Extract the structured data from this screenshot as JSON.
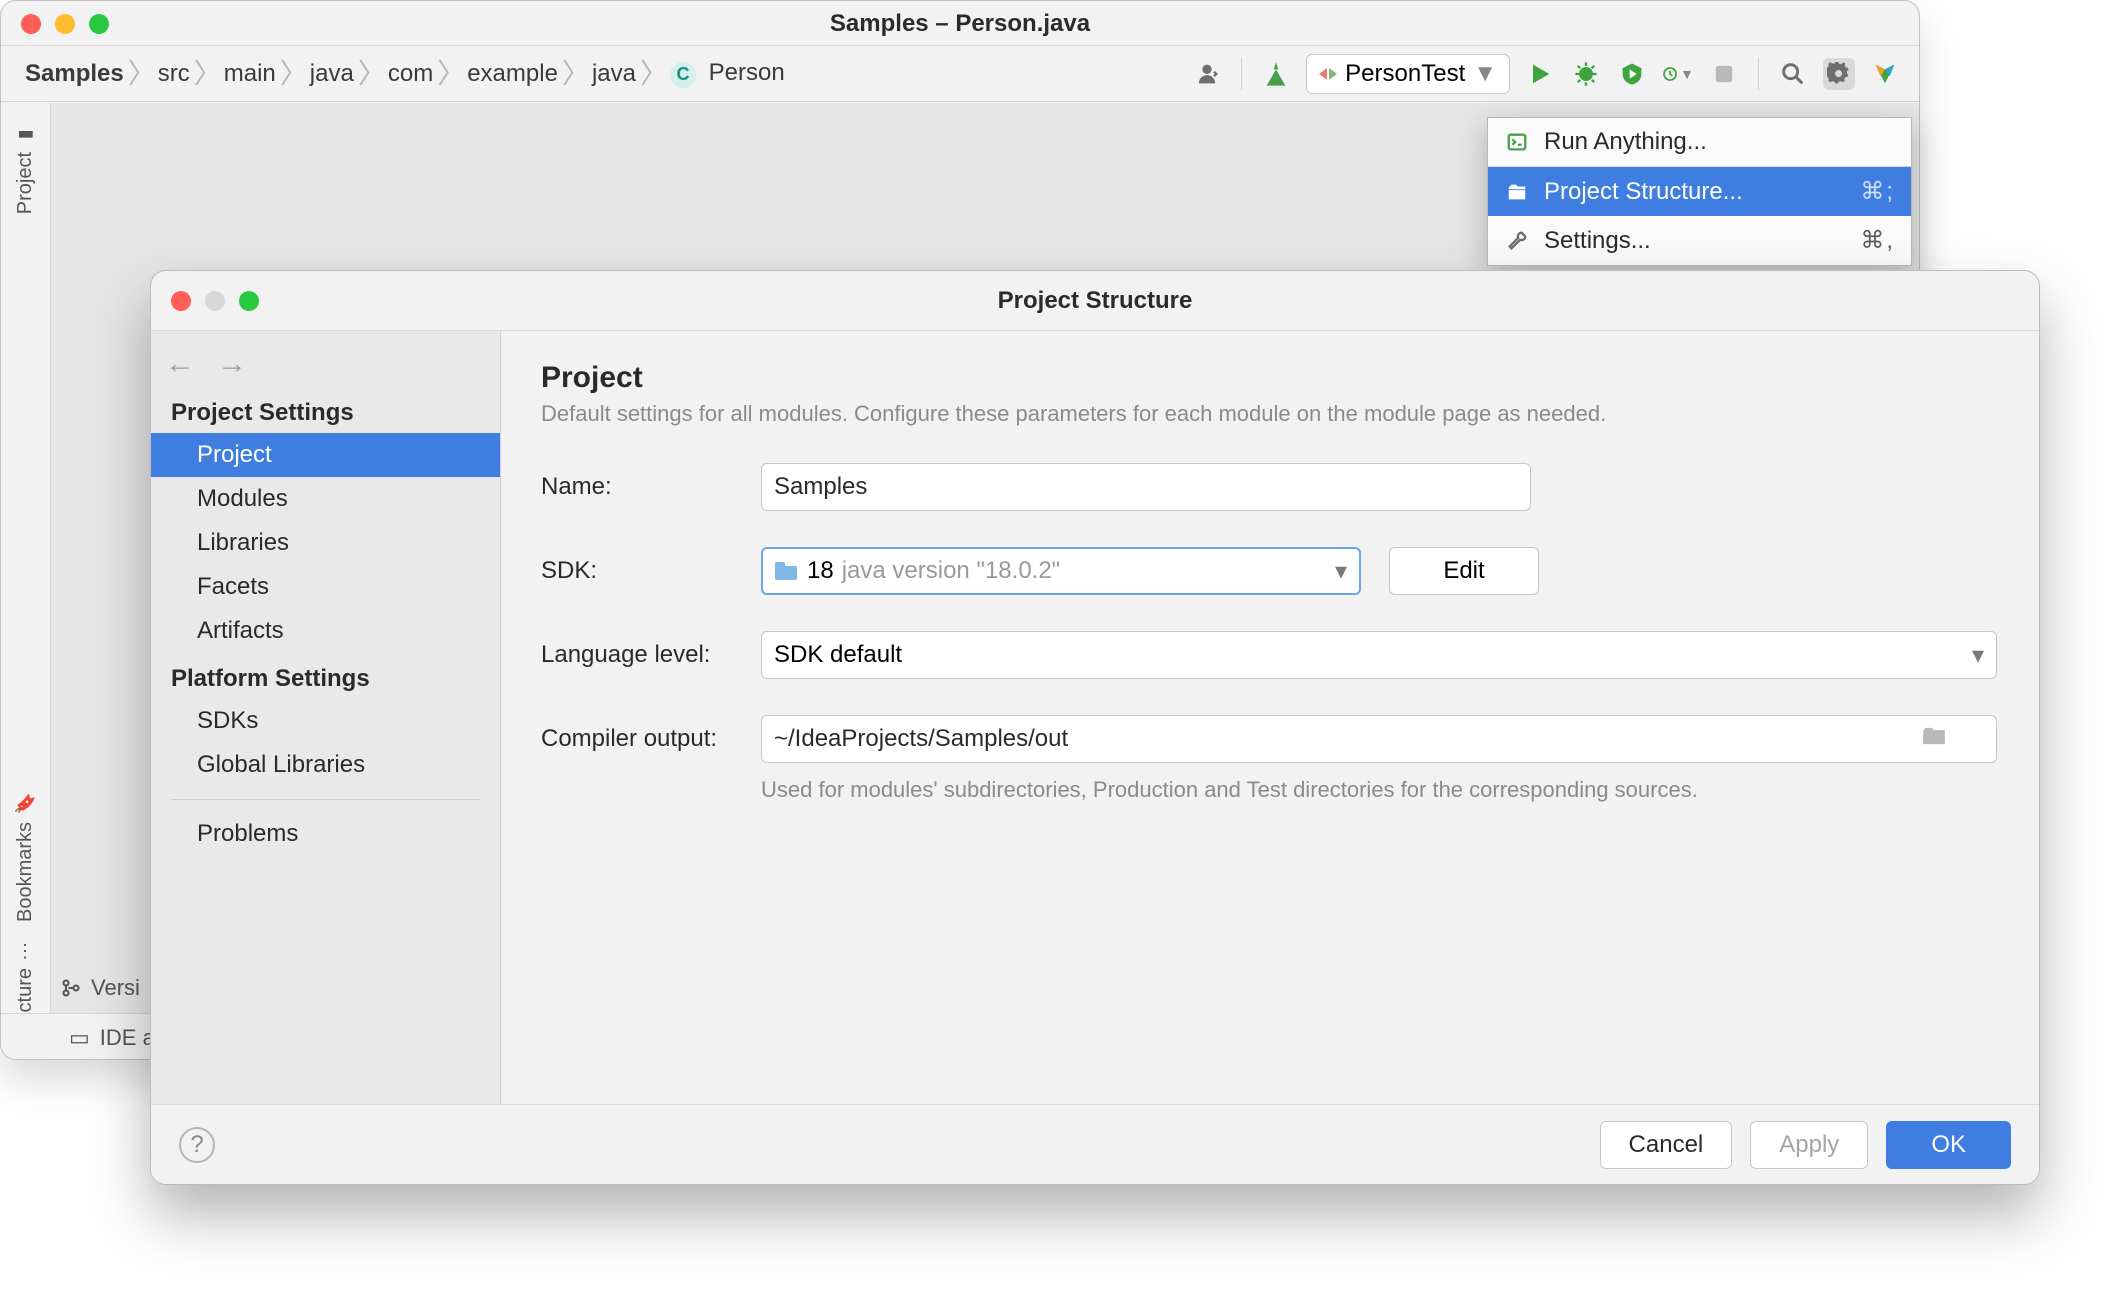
{
  "ide": {
    "window_title": "Samples – Person.java",
    "breadcrumbs": [
      "Samples",
      "src",
      "main",
      "java",
      "com",
      "example",
      "java",
      "Person"
    ],
    "run_config": "PersonTest",
    "left_tabs": {
      "project": "Project",
      "bookmarks": "Bookmarks",
      "structure": "Structure"
    },
    "statusbar": {
      "version_control": "Versi",
      "ide": "IDE ar"
    }
  },
  "gear_menu": {
    "run_anything": "Run Anything...",
    "project_structure": {
      "label": "Project Structure...",
      "shortcut": "⌘;"
    },
    "settings": {
      "label": "Settings...",
      "shortcut": "⌘,"
    }
  },
  "dialog": {
    "title": "Project Structure",
    "sections": {
      "project_settings": "Project Settings",
      "platform_settings": "Platform Settings"
    },
    "items": {
      "project": "Project",
      "modules": "Modules",
      "libraries": "Libraries",
      "facets": "Facets",
      "artifacts": "Artifacts",
      "sdks": "SDKs",
      "global_libraries": "Global Libraries",
      "problems": "Problems"
    },
    "form": {
      "heading": "Project",
      "description": "Default settings for all modules. Configure these parameters for each module on the module page as needed.",
      "name_label": "Name:",
      "name_value": "Samples",
      "sdk_label": "SDK:",
      "sdk_value_main": "18",
      "sdk_value_detail": "java version \"18.0.2\"",
      "edit": "Edit",
      "language_level_label": "Language level:",
      "language_level_value": "SDK default",
      "compiler_output_label": "Compiler output:",
      "compiler_output_value": "~/IdeaProjects/Samples/out",
      "compiler_output_hint": "Used for modules' subdirectories, Production and Test directories for the corresponding sources."
    },
    "buttons": {
      "help": "?",
      "cancel": "Cancel",
      "apply": "Apply",
      "ok": "OK"
    }
  }
}
